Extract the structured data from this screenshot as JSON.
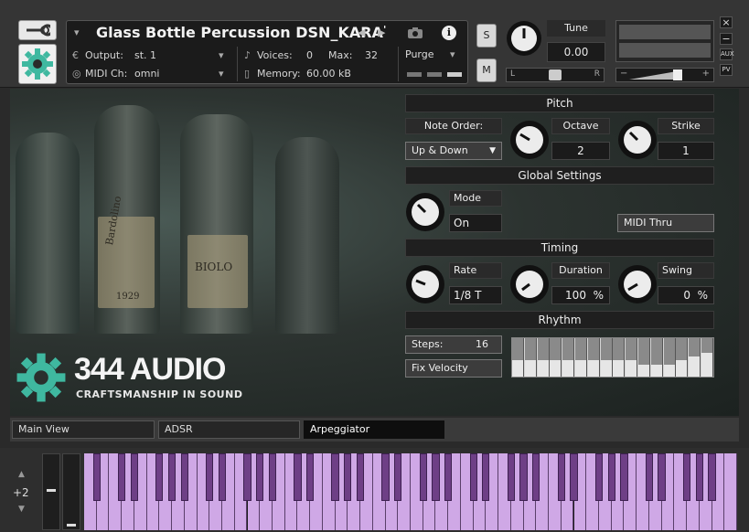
{
  "instrument": {
    "title": "Glass Bottle Percussion DSN_KARA",
    "title_suffix": "'",
    "output_label": "Output:",
    "output_value": "st. 1",
    "midi_label": "MIDI Ch:",
    "midi_value": "omni",
    "voices_label": "Voices:",
    "voices_value": "0",
    "max_label": "Max:",
    "max_value": "32",
    "memory_label": "Memory:",
    "memory_value": "60.00 kB",
    "purge_label": "Purge"
  },
  "header": {
    "solo_label": "S",
    "mute_label": "M",
    "tune_label": "Tune",
    "tune_value": "0.00",
    "pan_left": "L",
    "pan_right": "R",
    "vol_minus": "−",
    "vol_plus": "+",
    "close_label": "×",
    "minimize_label": "−",
    "aux_label": "AUX",
    "pv_label": "PV"
  },
  "pitch": {
    "section": "Pitch",
    "note_order_label": "Note Order:",
    "note_order_value": "Up & Down",
    "octave_label": "Octave",
    "octave_value": "2",
    "strike_label": "Strike",
    "strike_value": "1"
  },
  "global": {
    "section": "Global Settings",
    "mode_label": "Mode",
    "mode_value": "On",
    "midi_thru_label": "MIDI Thru"
  },
  "timing": {
    "section": "Timing",
    "rate_label": "Rate",
    "rate_value": "1/8 T",
    "duration_label": "Duration",
    "duration_value": "100",
    "duration_unit": "%",
    "swing_label": "Swing",
    "swing_value": "0",
    "swing_unit": "%"
  },
  "rhythm": {
    "section": "Rhythm",
    "steps_label": "Steps:",
    "steps_value": "16",
    "fix_velocity_label": "Fix Velocity",
    "step_levels": [
      0.42,
      0.42,
      0.42,
      0.42,
      0.42,
      0.42,
      0.42,
      0.42,
      0.42,
      0.42,
      0.32,
      0.32,
      0.32,
      0.42,
      0.52,
      0.62
    ]
  },
  "logo": {
    "name": "344 AUDIO",
    "tagline": "CRAFTSMANSHIP IN SOUND"
  },
  "background_labels": {
    "bottle1": "Bardolino",
    "year": "1929",
    "bottle2": "BIOLO"
  },
  "tabs": [
    {
      "label": "Main View"
    },
    {
      "label": "ADSR"
    },
    {
      "label": "Arpeggiator"
    }
  ],
  "keyboard": {
    "octave_value": "+2"
  },
  "colors": {
    "accent_teal": "#3fb8a0",
    "key_white": "#cfa8e6",
    "key_black": "#6e3f86"
  }
}
